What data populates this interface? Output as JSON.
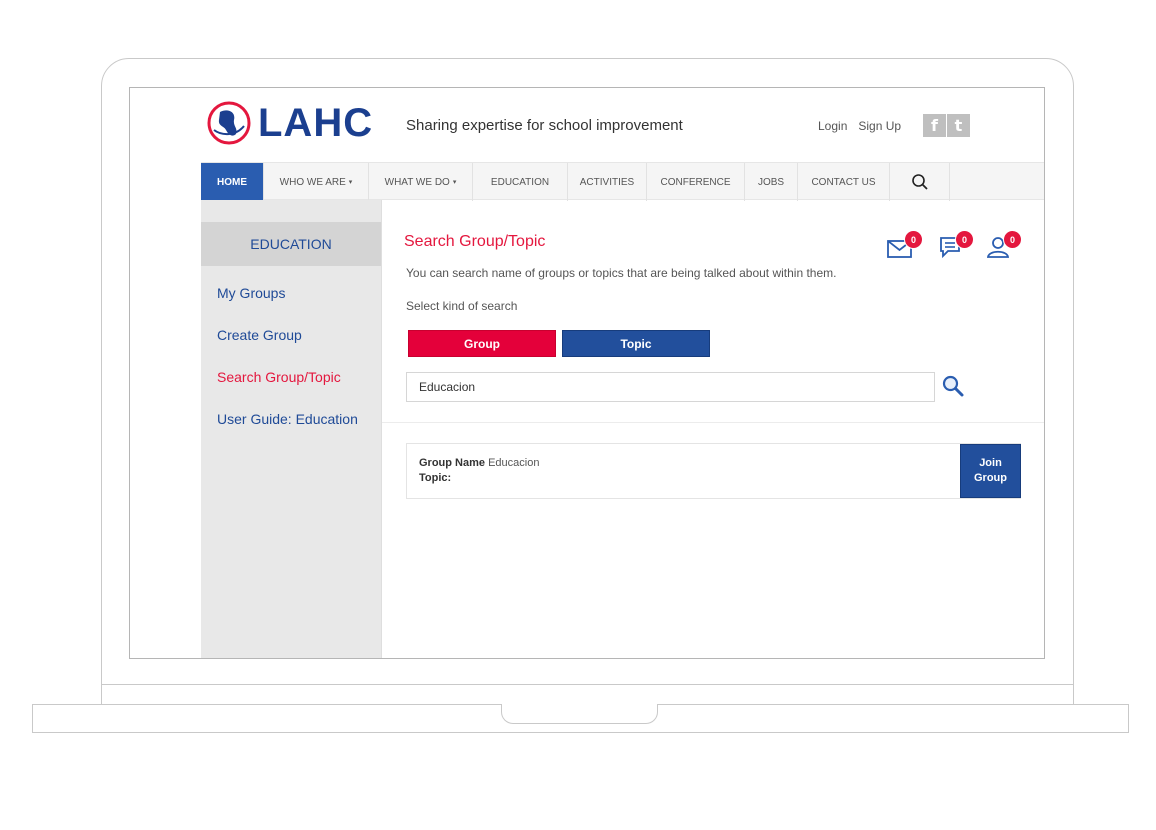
{
  "header": {
    "logo_text": "LAHC",
    "tagline": "Sharing expertise for school improvement",
    "login_label": "Login",
    "signup_label": "Sign Up",
    "facebook_glyph": "f",
    "twitter_glyph": "t"
  },
  "nav": {
    "items": [
      {
        "label": "HOME"
      },
      {
        "label": "WHO WE ARE"
      },
      {
        "label": "WHAT WE DO"
      },
      {
        "label": "EDUCATION"
      },
      {
        "label": "ACTIVITIES"
      },
      {
        "label": "CONFERENCE"
      },
      {
        "label": "JOBS"
      },
      {
        "label": "CONTACT US"
      }
    ],
    "dropdown_caret": "▾"
  },
  "sidebar": {
    "title": "EDUCATION",
    "links": [
      {
        "label": "My Groups"
      },
      {
        "label": "Create Group"
      },
      {
        "label": "Search Group/Topic"
      },
      {
        "label": "User Guide: Education"
      }
    ]
  },
  "main": {
    "title": "Search Group/Topic",
    "description": "You can search name of groups or topics that are being talked about within them.",
    "kind_label": "Select kind of search",
    "group_button": "Group",
    "topic_button": "Topic",
    "search_value": "Educacion",
    "notifications": {
      "messages": "0",
      "comments": "0",
      "users": "0"
    },
    "result": {
      "group_name_label": "Group Name",
      "group_name_value": "Educacion",
      "topic_label": "Topic:",
      "join_label_line1": "Join",
      "join_label_line2": "Group"
    }
  },
  "colors": {
    "brand_blue": "#224f9c",
    "accent_red": "#e4173e"
  }
}
